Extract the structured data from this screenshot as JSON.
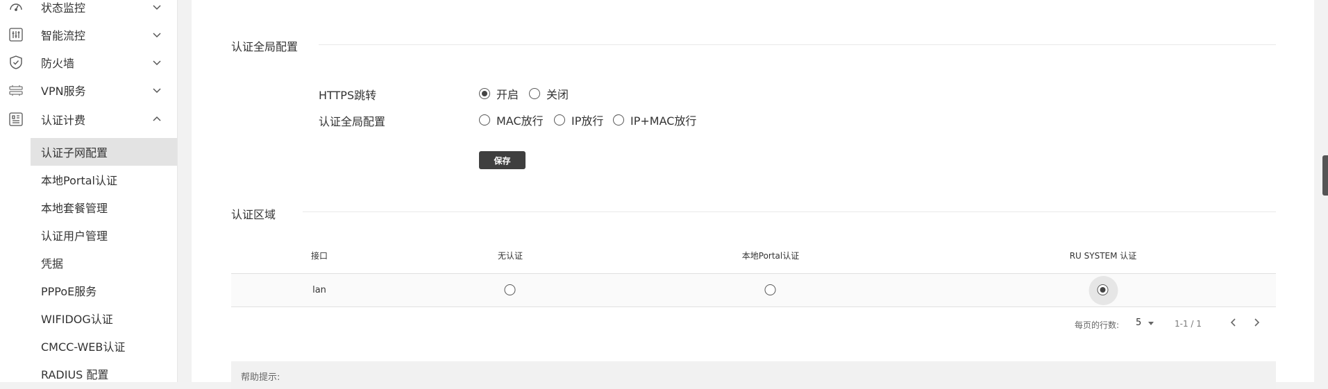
{
  "sidebar": {
    "groups": [
      {
        "label": "状态监控",
        "icon": "gauge-icon"
      },
      {
        "label": "智能流控",
        "icon": "sliders-icon"
      },
      {
        "label": "防火墙",
        "icon": "shield-icon"
      },
      {
        "label": "VPN服务",
        "icon": "vpn-icon"
      },
      {
        "label": "认证计费",
        "icon": "auth-billing-icon"
      }
    ],
    "sub_items": [
      {
        "label": "认证子网配置",
        "active": true
      },
      {
        "label": "本地Portal认证"
      },
      {
        "label": "本地套餐管理"
      },
      {
        "label": "认证用户管理"
      },
      {
        "label": "凭据"
      },
      {
        "label": "PPPoE服务"
      },
      {
        "label": "WIFIDOG认证"
      },
      {
        "label": "CMCC-WEB认证"
      },
      {
        "label": "RADIUS 配置"
      }
    ]
  },
  "global_config": {
    "section_title": "认证全局配置",
    "https_label": "HTTPS跳转",
    "https_options": [
      "开启",
      "关闭"
    ],
    "https_selected": "开启",
    "auth_label": "认证全局配置",
    "auth_options": [
      "MAC放行",
      "IP放行",
      "IP+MAC放行"
    ],
    "auth_selected": null,
    "save_label": "保存"
  },
  "auth_zone": {
    "section_title": "认证区域",
    "columns": [
      "接口",
      "无认证",
      "本地Portal认证",
      "RU SYSTEM 认证"
    ],
    "rows": [
      {
        "interface": "lan",
        "selected": "RU SYSTEM 认证"
      }
    ]
  },
  "pagination": {
    "rows_per_page_label": "每页的行数:",
    "rows_per_page": "5",
    "range": "1-1 / 1"
  },
  "help": {
    "label": "帮助提示:"
  },
  "colors": {
    "active_item_bg": "#e3e3e3",
    "button_bg": "#3f3f3f",
    "radio_color": "#444444"
  }
}
